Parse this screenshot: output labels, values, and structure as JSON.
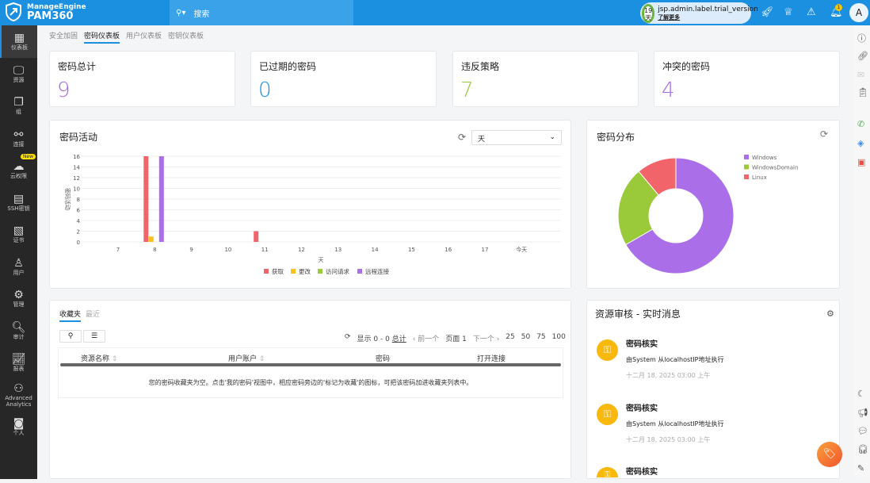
{
  "header": {
    "brand_top": "ManageEngine",
    "brand_name": "PAM360",
    "search_placeholder": "搜索",
    "trial_days": "19",
    "trial_days_unit": "天",
    "trial_label": "jsp.admin.label.trial_version",
    "trial_link": "了解更多",
    "notification_count": "1",
    "avatar_initial": "A"
  },
  "sidebar": {
    "items": [
      {
        "label": "仪表板",
        "icon": "dashboard-icon"
      },
      {
        "label": "资源",
        "icon": "monitor-icon"
      },
      {
        "label": "组",
        "icon": "group-icon"
      },
      {
        "label": "连接",
        "icon": "connection-icon"
      },
      {
        "label": "云权限",
        "icon": "cloud-shield-icon",
        "badge": "New"
      },
      {
        "label": "SSH密钥",
        "icon": "ssh-key-icon"
      },
      {
        "label": "证书",
        "icon": "certificate-icon"
      },
      {
        "label": "用户",
        "icon": "user-icon"
      },
      {
        "label": "管理",
        "icon": "gear-icon"
      },
      {
        "label": "审计",
        "icon": "audit-icon"
      },
      {
        "label": "报表",
        "icon": "report-icon"
      },
      {
        "label": "Advanced Analytics",
        "icon": "analytics-icon"
      },
      {
        "label": "个人",
        "icon": "personal-icon"
      }
    ]
  },
  "tabs": [
    "安全加固",
    "密码仪表板",
    "用户仪表板",
    "密钥仪表板"
  ],
  "stats": [
    {
      "label": "密码总计",
      "value": "9",
      "color": "#a56de2"
    },
    {
      "label": "已过期的密码",
      "value": "0",
      "color": "#1b8fe0"
    },
    {
      "label": "违反策略",
      "value": "7",
      "color": "#9ac93a"
    },
    {
      "label": "冲突的密码",
      "value": "4",
      "color": "#a56de2"
    }
  ],
  "activity": {
    "title": "密码活动",
    "period": "天"
  },
  "distribution": {
    "title": "密码分布"
  },
  "chart_data": [
    {
      "type": "bar",
      "title": "密码活动",
      "xlabel": "天",
      "ylabel": "密码活动",
      "ylim": [
        0,
        16
      ],
      "yticks": [
        0,
        2,
        4,
        6,
        8,
        10,
        12,
        14,
        16
      ],
      "categories": [
        "7",
        "8",
        "9",
        "10",
        "11",
        "12",
        "13",
        "14",
        "15",
        "16",
        "17",
        "今天"
      ],
      "series": [
        {
          "name": "获取",
          "color": "#f0646a",
          "values": [
            0,
            16,
            0,
            0,
            2,
            0,
            0,
            0,
            0,
            0,
            0,
            0
          ]
        },
        {
          "name": "更改",
          "color": "#f8c21a",
          "values": [
            0,
            1,
            0,
            0,
            0,
            0,
            0,
            0,
            0,
            0,
            0,
            0
          ]
        },
        {
          "name": "访问请求",
          "color": "#9ac93a",
          "values": [
            0,
            0,
            0,
            0,
            0,
            0,
            0,
            0,
            0,
            0,
            0,
            0
          ]
        },
        {
          "name": "远程连接",
          "color": "#a96ee8",
          "values": [
            0,
            16,
            0,
            0,
            0,
            0,
            0,
            0,
            0,
            0,
            0,
            0
          ]
        }
      ],
      "legend": "bottom",
      "grid": true
    },
    {
      "type": "pie",
      "title": "密码分布",
      "labels": [
        "Windows",
        "WindowsDomain",
        "Linux"
      ],
      "values": [
        6,
        2,
        1
      ],
      "colors": [
        "#a96ee8",
        "#9ac93a",
        "#f0646a"
      ],
      "legend": "top-right"
    }
  ],
  "favorites": {
    "tabs": [
      "收藏夹",
      "最近"
    ],
    "pager": {
      "showing": "显示 0 - 0",
      "total": "总计",
      "prev": "前一个",
      "page": "页面 1",
      "next": "下一个",
      "sizes": [
        "25",
        "50",
        "75",
        "100"
      ]
    },
    "columns": [
      "资源名称",
      "用户账户",
      "密码",
      "打开连接"
    ],
    "empty": "您的密码收藏夹为空。点击'我的密码'视图中，相应密码旁边的'标记为收藏'的图标，可把该密码加进收藏夹列表中。"
  },
  "audit": {
    "title": "资源审核 - 实时消息",
    "items": [
      {
        "title": "密码核实",
        "desc": "由System 从localhostIP地址执行",
        "time": "十二月 18, 2025 03:00 上午"
      },
      {
        "title": "密码核实",
        "desc": "由System 从localhostIP地址执行",
        "time": "十二月 18, 2025 03:00 上午"
      },
      {
        "title": "密码核实"
      }
    ]
  }
}
